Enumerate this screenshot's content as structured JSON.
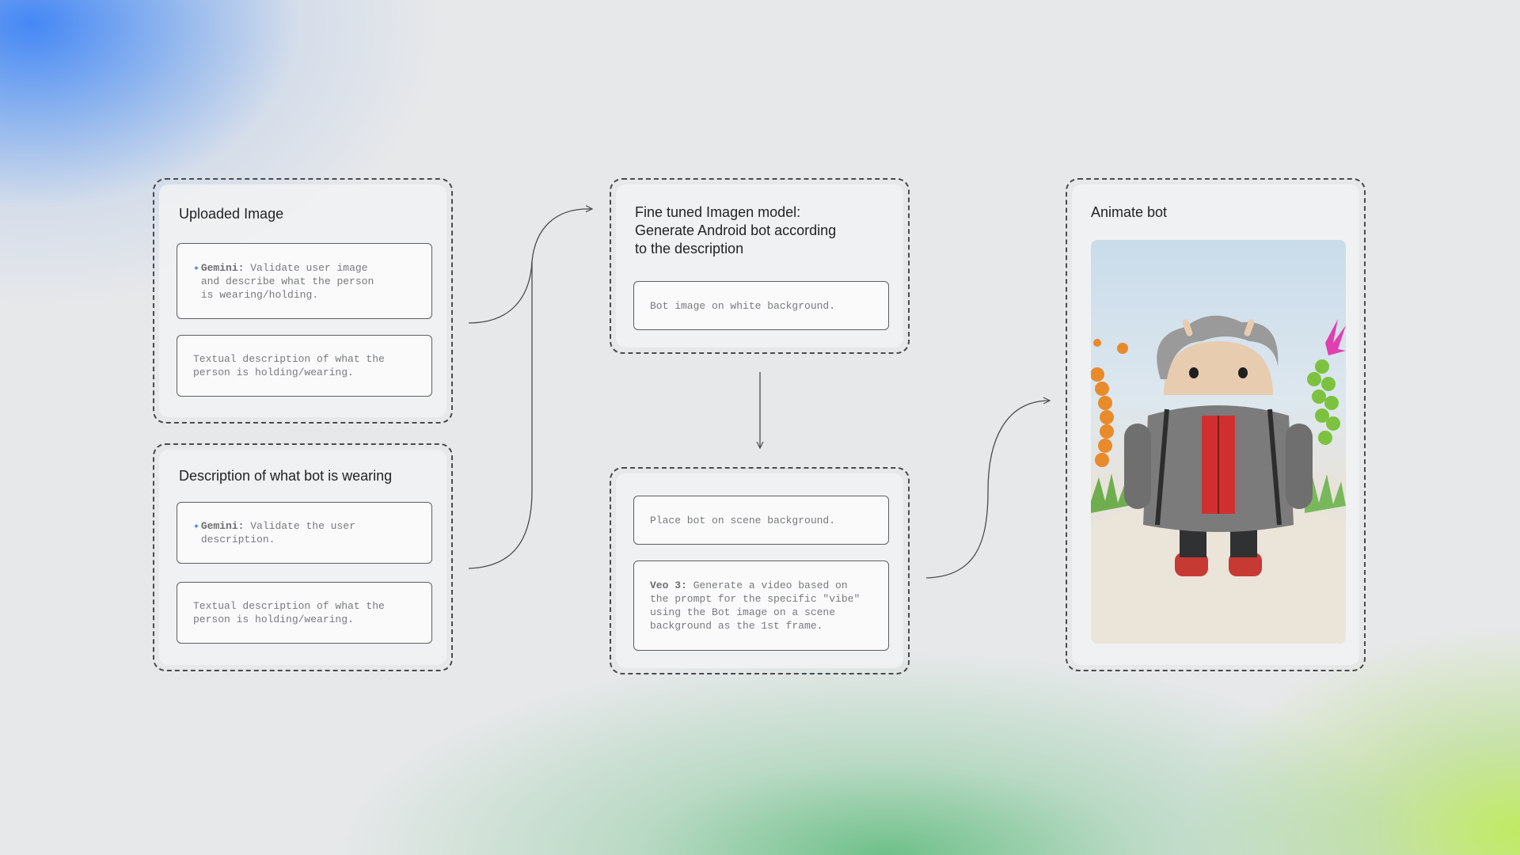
{
  "uploaded_image": {
    "title": "Uploaded Image",
    "gemini_label": "Gemini:",
    "gemini_text": "Validate user image\nand describe what the person\nis wearing/holding.",
    "output_text": "Textual description of what the\nperson is holding/wearing."
  },
  "description": {
    "title": "Description of what bot is wearing",
    "gemini_label": "Gemini:",
    "gemini_text": "Validate the user\ndescription.",
    "output_text": "Textual description of what the\nperson is holding/wearing."
  },
  "imagen": {
    "title": "Fine tuned Imagen model:\nGenerate Android bot according\nto the description",
    "output_text": "Bot image on white background."
  },
  "scene": {
    "place_text": "Place bot on scene background.",
    "veo_label": "Veo 3:",
    "veo_text": "Generate a video based on\nthe prompt for the specific \"vibe\"\nusing the Bot image on a scene\nbackground as the 1st frame."
  },
  "animate": {
    "title": "Animate bot"
  },
  "colors": {
    "accent_blue": "#4f7df0",
    "accent_green": "#5ab978",
    "accent_lime": "#bee95a"
  }
}
